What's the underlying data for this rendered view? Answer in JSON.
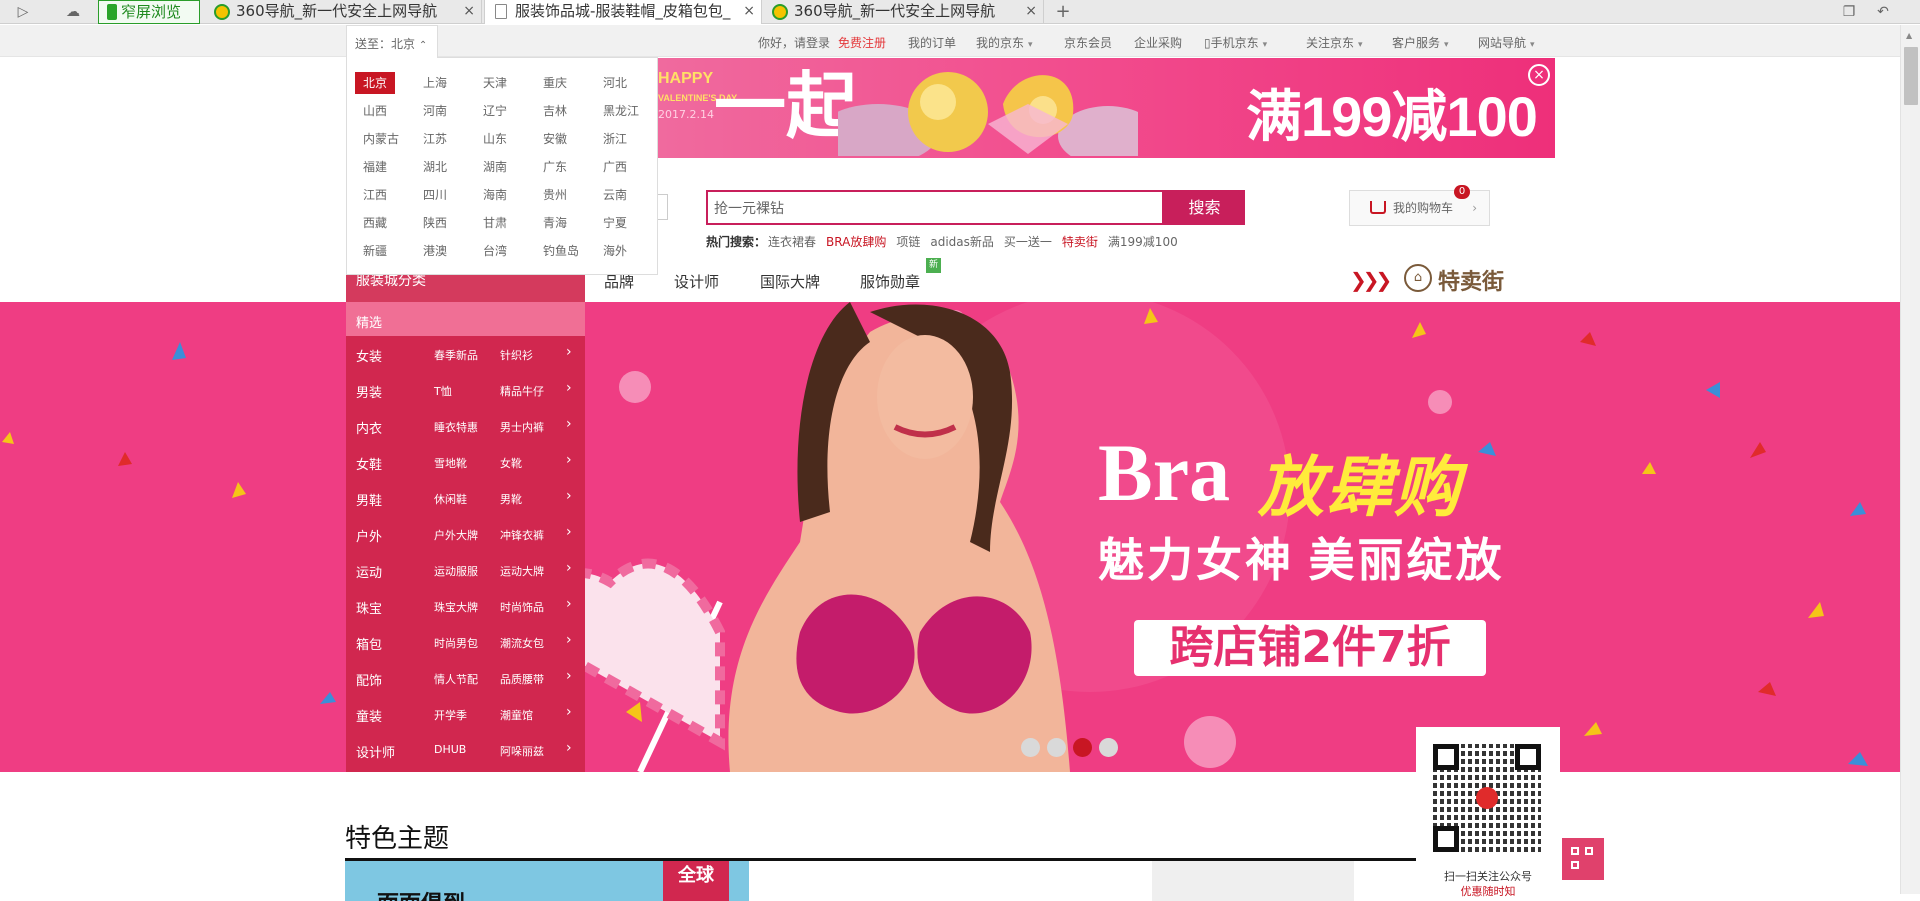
{
  "browser": {
    "wide_button": "窄屏浏览",
    "tabs": [
      {
        "title": "360导航_新一代安全上网导航"
      },
      {
        "title": "服装饰品城-服装鞋帽_皮箱包包_"
      },
      {
        "title": "360导航_新一代安全上网导航"
      }
    ],
    "new_tab": "+",
    "close": "×"
  },
  "topnav": {
    "ship_to_label": "送至：北京",
    "greeting": "你好，请登录",
    "register": "免费注册",
    "items": [
      "我的订单",
      "我的京东",
      "京东会员",
      "企业采购",
      "手机京东",
      "关注京东",
      "客户服务",
      "网站导航"
    ]
  },
  "location": {
    "selected": "北京",
    "cities": [
      [
        "北京",
        "上海",
        "天津",
        "重庆",
        "河北"
      ],
      [
        "山西",
        "河南",
        "辽宁",
        "吉林",
        "黑龙江"
      ],
      [
        "内蒙古",
        "江苏",
        "山东",
        "安徽",
        "浙江"
      ],
      [
        "福建",
        "湖北",
        "湖南",
        "广东",
        "广西"
      ],
      [
        "江西",
        "四川",
        "海南",
        "贵州",
        "云南"
      ],
      [
        "西藏",
        "陕西",
        "甘肃",
        "青海",
        "宁夏"
      ],
      [
        "新疆",
        "港澳",
        "台湾",
        "钓鱼岛",
        "海外"
      ]
    ]
  },
  "banner": {
    "happy": "HAPPY",
    "valentines": "VALENTINE'S DAY",
    "date": "2017.2.14",
    "big": "一起",
    "promo": "满199减100"
  },
  "search": {
    "value": "抢一元裸钻",
    "button": "搜索",
    "hot_label": "热门搜索：",
    "hot_terms": [
      {
        "text": "连衣裙春",
        "red": false
      },
      {
        "text": "BRA放肆购",
        "red": true
      },
      {
        "text": "项链",
        "red": false
      },
      {
        "text": "adidas新品",
        "red": false
      },
      {
        "text": "买一送一",
        "red": false
      },
      {
        "text": "特卖街",
        "red": true
      },
      {
        "text": "满199减100",
        "red": false
      }
    ]
  },
  "cart": {
    "label": "我的购物车",
    "count": "0"
  },
  "category": {
    "title": "服装城分类",
    "main_nav": [
      "品牌",
      "设计师",
      "国际大牌",
      "服饰勋章"
    ],
    "new_badge": "新",
    "sale_street": "特卖街",
    "featured": "精选",
    "rows": [
      {
        "main": "女装",
        "a": "春季新品",
        "b": "针织衫"
      },
      {
        "main": "男装",
        "a": "T恤",
        "b": "精品牛仔"
      },
      {
        "main": "内衣",
        "a": "睡衣特惠",
        "b": "男士内裤"
      },
      {
        "main": "女鞋",
        "a": "雪地靴",
        "b": "女靴"
      },
      {
        "main": "男鞋",
        "a": "休闲鞋",
        "b": "男靴"
      },
      {
        "main": "户外",
        "a": "户外大牌",
        "b": "冲锋衣裤"
      },
      {
        "main": "运动",
        "a": "运动服服",
        "b": "运动大牌"
      },
      {
        "main": "珠宝",
        "a": "珠宝大牌",
        "b": "时尚饰品"
      },
      {
        "main": "箱包",
        "a": "时尚男包",
        "b": "潮流女包"
      },
      {
        "main": "配饰",
        "a": "情人节配",
        "b": "品质腰带"
      },
      {
        "main": "童装",
        "a": "开学季",
        "b": "潮童馆"
      },
      {
        "main": "设计师",
        "a": "DHUB",
        "b": "阿哚丽兹"
      }
    ]
  },
  "hero": {
    "bra": "Bra",
    "fang": "放肆购",
    "subtitle": "魅力女神 美丽绽放",
    "offer": "跨店铺2件7折",
    "active_slide": 3,
    "slide_count": 4
  },
  "qr": {
    "caption1": "扫一扫关注公众号",
    "caption2": "优惠随时知"
  },
  "section": {
    "title": "特色主题",
    "tile_title": "面面俱到",
    "tile_tag": "全球"
  },
  "colors": {
    "brand": "#c81623",
    "accent": "#ef3d83",
    "menu": "#d1274f"
  }
}
